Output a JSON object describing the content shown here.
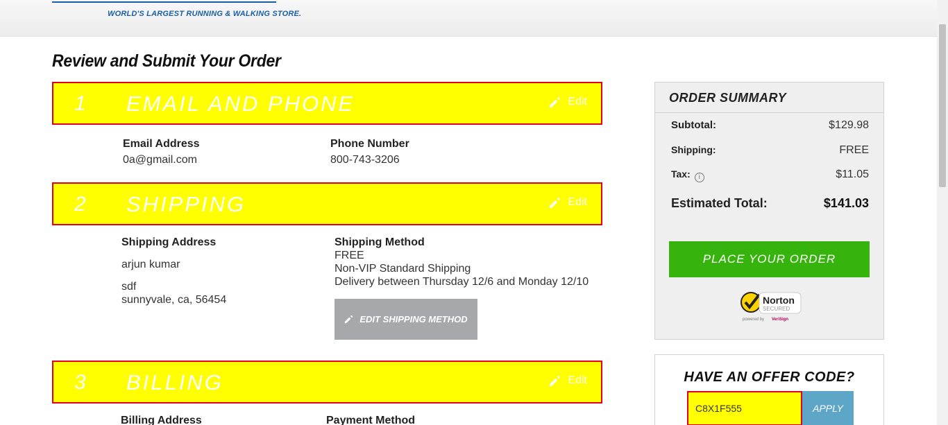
{
  "header": {
    "tagline": "WORLD'S LARGEST RUNNING & WALKING STORE."
  },
  "page": {
    "title": "Review and Submit Your Order"
  },
  "sections": [
    {
      "number": "1",
      "title": "EMAIL AND PHONE",
      "edit_label": "Edit"
    },
    {
      "number": "2",
      "title": "SHIPPING",
      "edit_label": "Edit"
    },
    {
      "number": "3",
      "title": "BILLING",
      "edit_label": "Edit"
    }
  ],
  "contact": {
    "email_label": "Email Address",
    "email": "0a@gmail.com",
    "phone_label": "Phone Number",
    "phone": "800-743-3206"
  },
  "shipping": {
    "address_label": "Shipping Address",
    "name": "arjun kumar",
    "street": "sdf",
    "city_line": "sunnyvale, ca, 56454",
    "method_label": "Shipping Method",
    "method_price": "FREE",
    "method_name": "Non-VIP Standard Shipping",
    "delivery": "Delivery between Thursday 12/6 and Monday 12/10",
    "edit_method_label": "EDIT SHIPPING METHOD"
  },
  "billing": {
    "address_label": "Billing Address",
    "payment_label": "Payment Method"
  },
  "summary": {
    "title": "ORDER SUMMARY",
    "subtotal_label": "Subtotal:",
    "subtotal": "$129.98",
    "shipping_label": "Shipping:",
    "shipping": "FREE",
    "tax_label": "Tax:",
    "tax": "$11.05",
    "total_label": "Estimated Total:",
    "total": "$141.03",
    "place_order_label": "PLACE YOUR ORDER",
    "badge": {
      "name": "Norton",
      "secured": "SECURED",
      "powered": "powered by",
      "brand": "VeriSign"
    }
  },
  "offer": {
    "title": "HAVE AN OFFER CODE?",
    "code": "C8X1F555",
    "apply_label": "APPLY"
  },
  "colors": {
    "section_bar": "#ffff00",
    "section_border": "#e3001b",
    "place_order": "#36b30c",
    "apply": "#5da6c8",
    "edit_shipping": "#a6a8ab",
    "brand_blue": "#1a5fa6"
  },
  "icons": {
    "edit": "pencil-icon",
    "info": "info-icon",
    "badge": "norton-check-icon"
  }
}
